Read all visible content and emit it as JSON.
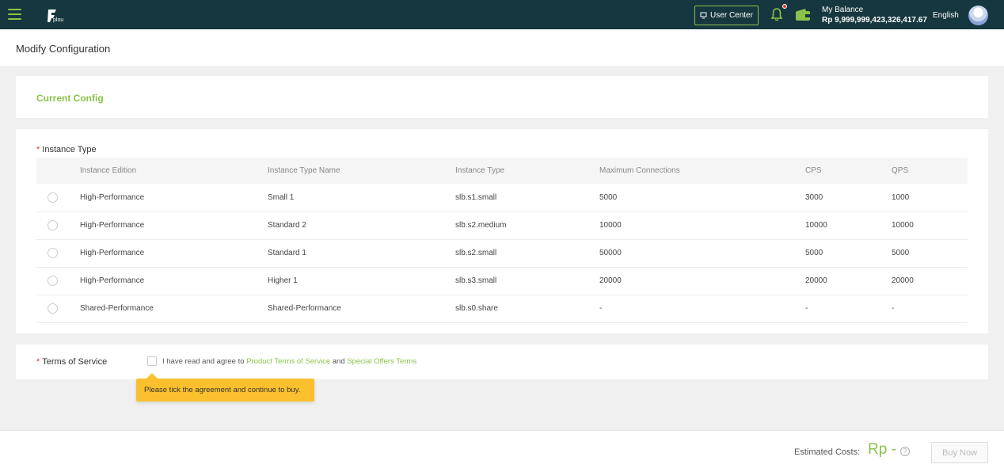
{
  "header": {
    "user_center_label": "User Center",
    "balance_label": "My Balance",
    "balance_value": "Rp 9,999,999,423,326,417.67",
    "language": "English",
    "logo_text": "plou",
    "accent_color": "#8bc34a"
  },
  "page": {
    "title": "Modify Configuration"
  },
  "current_config": {
    "title": "Current Config"
  },
  "instance_type": {
    "label": "Instance Type",
    "required_mark": "*",
    "columns": [
      "Instance Edition",
      "Instance Type Name",
      "Instance Type",
      "Maximum Connections",
      "CPS",
      "QPS"
    ],
    "rows": [
      [
        "High-Performance",
        "Small 1",
        "slb.s1.small",
        "5000",
        "3000",
        "1000"
      ],
      [
        "High-Performance",
        "Standard 2",
        "slb.s2.medium",
        "10000",
        "10000",
        "10000"
      ],
      [
        "High-Performance",
        "Standard 1",
        "slb.s2.small",
        "50000",
        "5000",
        "5000"
      ],
      [
        "High-Performance",
        "Higher 1",
        "slb.s3.small",
        "20000",
        "20000",
        "20000"
      ],
      [
        "Shared-Performance",
        "Shared-Performance",
        "slb.s0.share",
        "-",
        "-",
        "-"
      ]
    ]
  },
  "terms": {
    "label": "Terms of Service",
    "required_mark": "*",
    "agree_prefix": "I have read and agree to",
    "product_terms": "Product Terms of Service",
    "and": "and",
    "special_terms": "Special Offers Terms",
    "tooltip": "Please tick the agreement and continue to buy."
  },
  "footer": {
    "estimated_label": "Estimated Costs:",
    "estimated_value": "Rp -",
    "help_symbol": "?",
    "buy_label": "Buy Now"
  }
}
